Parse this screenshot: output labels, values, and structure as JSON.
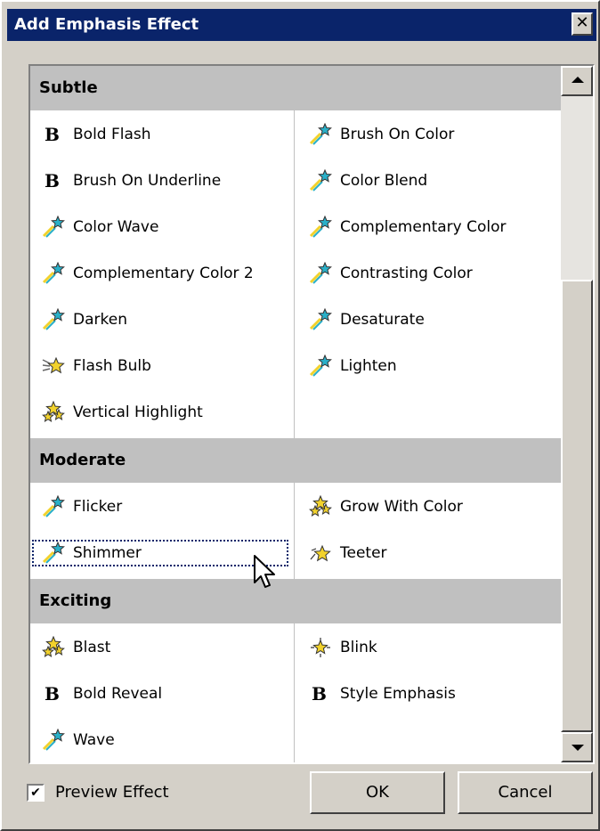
{
  "window": {
    "title": "Add Emphasis Effect",
    "close_glyph": "✕"
  },
  "groups": [
    {
      "name": "Subtle",
      "items": [
        [
          "Bold Flash",
          "bold-b"
        ],
        [
          "Brush On Color",
          "shooting-star"
        ],
        [
          "Brush On Underline",
          "bold-b"
        ],
        [
          "Color Blend",
          "shooting-star"
        ],
        [
          "Color Wave",
          "shooting-star"
        ],
        [
          "Complementary Color",
          "shooting-star"
        ],
        [
          "Complementary Color 2",
          "shooting-star"
        ],
        [
          "Contrasting Color",
          "shooting-star"
        ],
        [
          "Darken",
          "shooting-star"
        ],
        [
          "Desaturate",
          "shooting-star"
        ],
        [
          "Flash Bulb",
          "flash-bulb"
        ],
        [
          "Lighten",
          "shooting-star"
        ],
        [
          "Vertical Highlight",
          "star-burst"
        ]
      ]
    },
    {
      "name": "Moderate",
      "items": [
        [
          "Flicker",
          "shooting-star"
        ],
        [
          "Grow With Color",
          "star-burst"
        ],
        [
          "Shimmer",
          "shooting-star"
        ],
        [
          "Teeter",
          "teeter-star"
        ]
      ]
    },
    {
      "name": "Exciting",
      "items": [
        [
          "Blast",
          "star-burst"
        ],
        [
          "Blink",
          "blink-star"
        ],
        [
          "Bold Reveal",
          "bold-b"
        ],
        [
          "Style Emphasis",
          "bold-b"
        ],
        [
          "Wave",
          "shooting-star"
        ]
      ]
    }
  ],
  "selected_item": "Shimmer",
  "preview": {
    "label": "Preview Effect",
    "checked": true,
    "check_glyph": "✔"
  },
  "buttons": {
    "ok": "OK",
    "cancel": "Cancel"
  },
  "colors": {
    "titlebar": "#0a246a",
    "group_header": "#c0c0c0",
    "star": "#f2d22c",
    "streak": "#2ab0c8"
  }
}
